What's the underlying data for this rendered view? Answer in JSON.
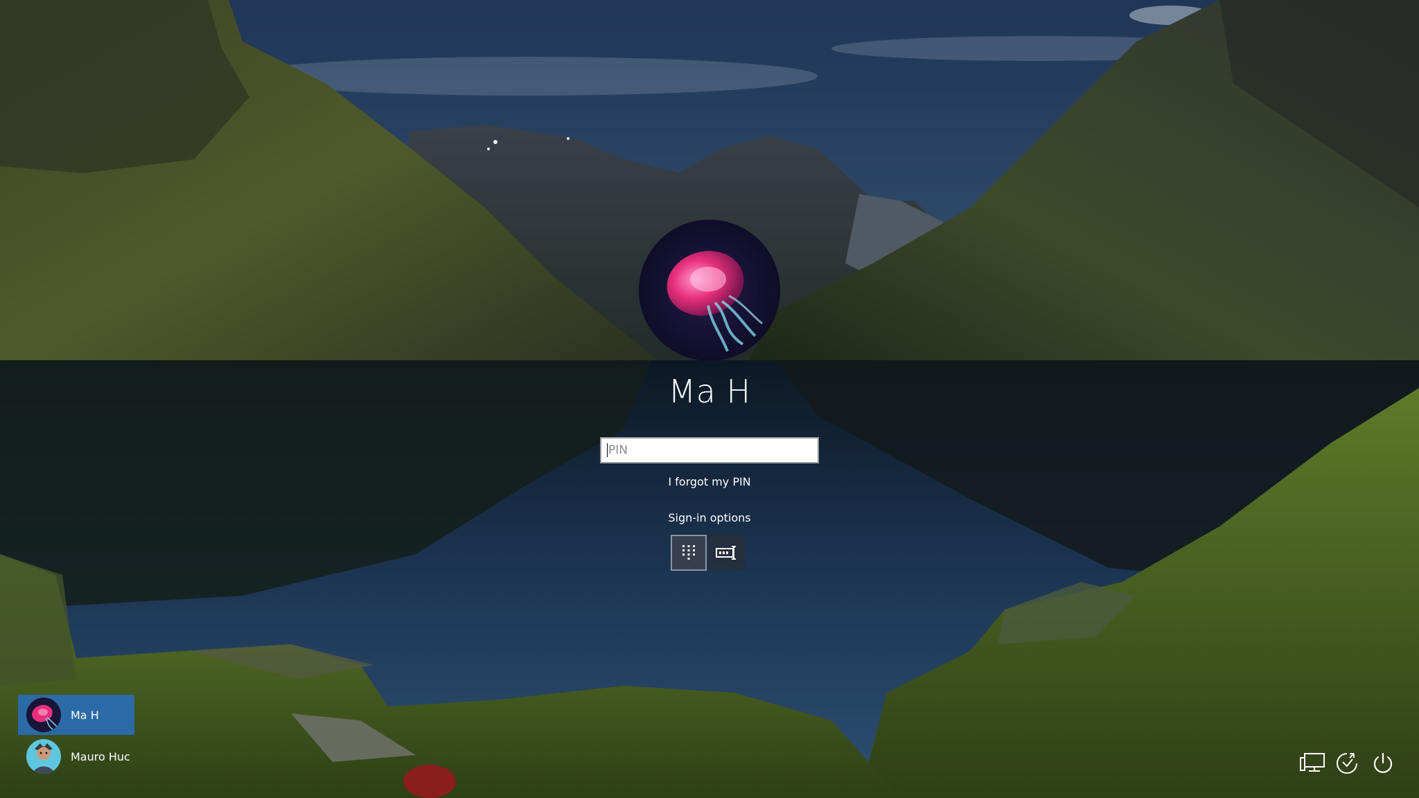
{
  "lock_screen": {
    "background": "mountain-lake-landscape",
    "accent_color": "#2d6ec0"
  },
  "current_user": {
    "name": "Ma H",
    "avatar": "jellyfish-avatar"
  },
  "pin_input": {
    "placeholder": "PIN",
    "value": ""
  },
  "links": {
    "forgot_pin": "I forgot my PIN",
    "signin_options": "Sign-in options"
  },
  "signin_methods": [
    {
      "icon": "pin-keypad-icon",
      "selected": true
    },
    {
      "icon": "password-key-icon",
      "selected": false
    }
  ],
  "user_list": [
    {
      "name": "Ma H",
      "avatar": "jellyfish-avatar",
      "active": true
    },
    {
      "name": "Mauro Huc",
      "avatar": "character-avatar",
      "active": false
    }
  ],
  "system_buttons": [
    {
      "icon": "network-icon"
    },
    {
      "icon": "ease-of-access-icon"
    },
    {
      "icon": "power-icon"
    }
  ]
}
